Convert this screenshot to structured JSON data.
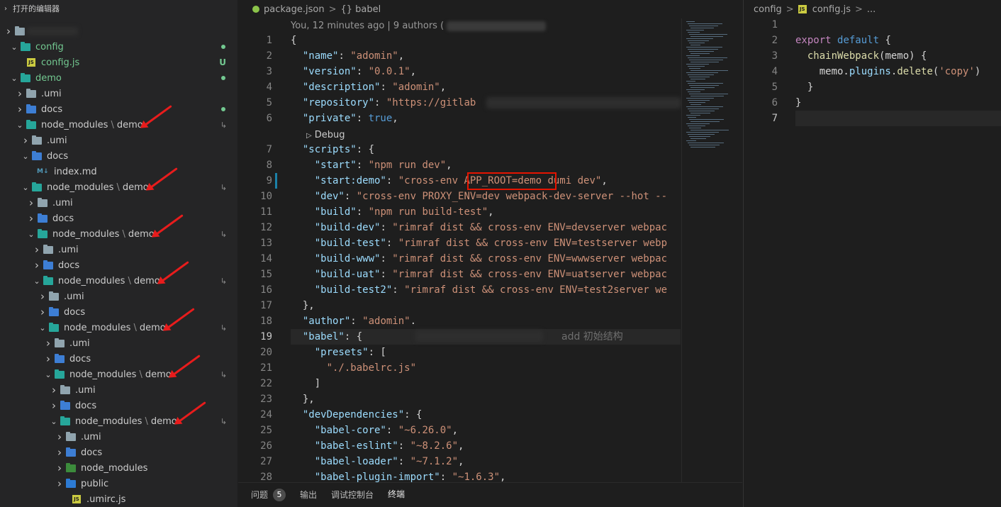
{
  "sidebar": {
    "open_editors_label": "打开的编辑器",
    "rows": [
      {
        "label": "",
        "kind": "folder",
        "indent": 0,
        "open": false,
        "green": false
      },
      {
        "label": "config",
        "kind": "folder-teal",
        "indent": 1,
        "open": true,
        "green": true,
        "badge": "dot"
      },
      {
        "label": "config.js",
        "kind": "js",
        "indent": 2,
        "open": null,
        "green": true,
        "badge": "U"
      },
      {
        "label": "demo",
        "kind": "folder-teal",
        "indent": 1,
        "open": true,
        "green": true,
        "badge": "dot"
      },
      {
        "label": ".umi",
        "kind": "folder",
        "indent": 2,
        "open": false,
        "green": false
      },
      {
        "label": "docs",
        "kind": "folder-docs",
        "indent": 2,
        "open": false,
        "green": false,
        "badge": "dot"
      },
      {
        "label": "node_modules",
        "suffix": "demo",
        "kind": "folder-teal",
        "indent": 2,
        "open": true,
        "green": false,
        "badge": "link"
      },
      {
        "label": ".umi",
        "kind": "folder",
        "indent": 3,
        "open": false,
        "green": false
      },
      {
        "label": "docs",
        "kind": "folder-docs",
        "indent": 3,
        "open": true,
        "green": false
      },
      {
        "label": "index.md",
        "kind": "md",
        "indent": 4,
        "open": null,
        "green": false
      },
      {
        "label": "node_modules",
        "suffix": "demo",
        "kind": "folder-teal",
        "indent": 3,
        "open": true,
        "green": false,
        "badge": "link"
      },
      {
        "label": ".umi",
        "kind": "folder",
        "indent": 4,
        "open": false,
        "green": false
      },
      {
        "label": "docs",
        "kind": "folder-docs",
        "indent": 4,
        "open": false,
        "green": false
      },
      {
        "label": "node_modules",
        "suffix": "demo",
        "kind": "folder-teal",
        "indent": 4,
        "open": true,
        "green": false,
        "badge": "link"
      },
      {
        "label": ".umi",
        "kind": "folder",
        "indent": 5,
        "open": false,
        "green": false
      },
      {
        "label": "docs",
        "kind": "folder-docs",
        "indent": 5,
        "open": false,
        "green": false
      },
      {
        "label": "node_modules",
        "suffix": "demo",
        "kind": "folder-teal",
        "indent": 5,
        "open": true,
        "green": false,
        "badge": "link"
      },
      {
        "label": ".umi",
        "kind": "folder",
        "indent": 6,
        "open": false,
        "green": false
      },
      {
        "label": "docs",
        "kind": "folder-docs",
        "indent": 6,
        "open": false,
        "green": false
      },
      {
        "label": "node_modules",
        "suffix": "demo",
        "kind": "folder-teal",
        "indent": 6,
        "open": true,
        "green": false,
        "badge": "link"
      },
      {
        "label": ".umi",
        "kind": "folder",
        "indent": 7,
        "open": false,
        "green": false
      },
      {
        "label": "docs",
        "kind": "folder-docs",
        "indent": 7,
        "open": false,
        "green": false
      },
      {
        "label": "node_modules",
        "suffix": "demo",
        "kind": "folder-teal",
        "indent": 7,
        "open": true,
        "green": false,
        "badge": "link"
      },
      {
        "label": ".umi",
        "kind": "folder",
        "indent": 8,
        "open": false,
        "green": false
      },
      {
        "label": "docs",
        "kind": "folder-docs",
        "indent": 8,
        "open": false,
        "green": false
      },
      {
        "label": "node_modules",
        "suffix": "demo",
        "kind": "folder-teal",
        "indent": 8,
        "open": true,
        "green": false,
        "badge": "link"
      },
      {
        "label": ".umi",
        "kind": "folder",
        "indent": 9,
        "open": false,
        "green": false
      },
      {
        "label": "docs",
        "kind": "folder-docs",
        "indent": 9,
        "open": false,
        "green": false
      },
      {
        "label": "node_modules",
        "kind": "folder-nm",
        "indent": 9,
        "open": false,
        "green": false
      },
      {
        "label": "public",
        "kind": "folder-public",
        "indent": 9,
        "open": false,
        "green": false
      },
      {
        "label": ".umirc.js",
        "kind": "js",
        "indent": 10,
        "open": null,
        "green": false
      }
    ]
  },
  "editor1": {
    "breadcrumb": {
      "file": "package.json",
      "sep": ">",
      "symbol": "{} babel"
    },
    "codelens_blame": "You, 12 minutes ago | 9 authors (",
    "debug_lens": "Debug",
    "inline_commit_hint": "add 初始结构",
    "lines": [
      {
        "n": "1",
        "segs": [
          [
            "p",
            "{"
          ]
        ]
      },
      {
        "n": "2",
        "segs": [
          [
            "p",
            "  "
          ],
          [
            "k",
            "\"name\""
          ],
          [
            "p",
            ": "
          ],
          [
            "s",
            "\"adomin\""
          ],
          [
            "p",
            ","
          ]
        ]
      },
      {
        "n": "3",
        "segs": [
          [
            "p",
            "  "
          ],
          [
            "k",
            "\"version\""
          ],
          [
            "p",
            ": "
          ],
          [
            "s",
            "\"0.0.1\""
          ],
          [
            "p",
            ","
          ]
        ]
      },
      {
        "n": "4",
        "segs": [
          [
            "p",
            "  "
          ],
          [
            "k",
            "\"description\""
          ],
          [
            "p",
            ": "
          ],
          [
            "s",
            "\"adomin\""
          ],
          [
            "p",
            ","
          ]
        ]
      },
      {
        "n": "5",
        "segs": [
          [
            "p",
            "  "
          ],
          [
            "k",
            "\"repository\""
          ],
          [
            "p",
            ": "
          ],
          [
            "s",
            "\"https://gitlab"
          ]
        ]
      },
      {
        "n": "6",
        "segs": [
          [
            "p",
            "  "
          ],
          [
            "k",
            "\"private\""
          ],
          [
            "p",
            ": "
          ],
          [
            "b",
            "true"
          ],
          [
            "p",
            ","
          ]
        ]
      },
      {
        "n": "7",
        "segs": [
          [
            "p",
            "  "
          ],
          [
            "k",
            "\"scripts\""
          ],
          [
            "p",
            ": {"
          ]
        ]
      },
      {
        "n": "8",
        "segs": [
          [
            "p",
            "    "
          ],
          [
            "k",
            "\"start\""
          ],
          [
            "p",
            ": "
          ],
          [
            "s",
            "\"npm run dev\""
          ],
          [
            "p",
            ","
          ]
        ]
      },
      {
        "n": "9",
        "segs": [
          [
            "p",
            "    "
          ],
          [
            "k",
            "\"start:demo\""
          ],
          [
            "p",
            ": "
          ],
          [
            "s",
            "\"cross-env APP_ROOT=demo dumi dev\""
          ],
          [
            "p",
            ","
          ]
        ]
      },
      {
        "n": "10",
        "segs": [
          [
            "p",
            "    "
          ],
          [
            "k",
            "\"dev\""
          ],
          [
            "p",
            ": "
          ],
          [
            "s",
            "\"cross-env PROXY_ENV=dev webpack-dev-server --hot --"
          ]
        ]
      },
      {
        "n": "11",
        "segs": [
          [
            "p",
            "    "
          ],
          [
            "k",
            "\"build\""
          ],
          [
            "p",
            ": "
          ],
          [
            "s",
            "\"npm run build-test\""
          ],
          [
            "p",
            ","
          ]
        ]
      },
      {
        "n": "12",
        "segs": [
          [
            "p",
            "    "
          ],
          [
            "k",
            "\"build-dev\""
          ],
          [
            "p",
            ": "
          ],
          [
            "s",
            "\"rimraf dist && cross-env ENV=devserver webpac"
          ]
        ]
      },
      {
        "n": "13",
        "segs": [
          [
            "p",
            "    "
          ],
          [
            "k",
            "\"build-test\""
          ],
          [
            "p",
            ": "
          ],
          [
            "s",
            "\"rimraf dist && cross-env ENV=testserver webp"
          ]
        ]
      },
      {
        "n": "14",
        "segs": [
          [
            "p",
            "    "
          ],
          [
            "k",
            "\"build-www\""
          ],
          [
            "p",
            ": "
          ],
          [
            "s",
            "\"rimraf dist && cross-env ENV=wwwserver webpac"
          ]
        ]
      },
      {
        "n": "15",
        "segs": [
          [
            "p",
            "    "
          ],
          [
            "k",
            "\"build-uat\""
          ],
          [
            "p",
            ": "
          ],
          [
            "s",
            "\"rimraf dist && cross-env ENV=uatserver webpac"
          ]
        ]
      },
      {
        "n": "16",
        "segs": [
          [
            "p",
            "    "
          ],
          [
            "k",
            "\"build-test2\""
          ],
          [
            "p",
            ": "
          ],
          [
            "s",
            "\"rimraf dist && cross-env ENV=test2server we"
          ]
        ]
      },
      {
        "n": "17",
        "segs": [
          [
            "p",
            "  },"
          ]
        ]
      },
      {
        "n": "18",
        "segs": [
          [
            "p",
            "  "
          ],
          [
            "k",
            "\"author\""
          ],
          [
            "p",
            ": "
          ],
          [
            "s",
            "\"adomin\""
          ],
          [
            "p",
            "."
          ]
        ]
      },
      {
        "n": "19",
        "segs": [
          [
            "p",
            "  "
          ],
          [
            "k",
            "\"babel\""
          ],
          [
            "p",
            ": {"
          ]
        ]
      },
      {
        "n": "20",
        "segs": [
          [
            "p",
            "    "
          ],
          [
            "k",
            "\"presets\""
          ],
          [
            "p",
            ": ["
          ]
        ]
      },
      {
        "n": "21",
        "segs": [
          [
            "p",
            "      "
          ],
          [
            "s",
            "\"./.babelrc.js\""
          ]
        ]
      },
      {
        "n": "22",
        "segs": [
          [
            "p",
            "    ]"
          ]
        ]
      },
      {
        "n": "23",
        "segs": [
          [
            "p",
            "  },"
          ]
        ]
      },
      {
        "n": "24",
        "segs": [
          [
            "p",
            "  "
          ],
          [
            "k",
            "\"devDependencies\""
          ],
          [
            "p",
            ": {"
          ]
        ]
      },
      {
        "n": "25",
        "segs": [
          [
            "p",
            "    "
          ],
          [
            "k",
            "\"babel-core\""
          ],
          [
            "p",
            ": "
          ],
          [
            "s",
            "\"~6.26.0\""
          ],
          [
            "p",
            ","
          ]
        ]
      },
      {
        "n": "26",
        "segs": [
          [
            "p",
            "    "
          ],
          [
            "k",
            "\"babel-eslint\""
          ],
          [
            "p",
            ": "
          ],
          [
            "s",
            "\"~8.2.6\""
          ],
          [
            "p",
            ","
          ]
        ]
      },
      {
        "n": "27",
        "segs": [
          [
            "p",
            "    "
          ],
          [
            "k",
            "\"babel-loader\""
          ],
          [
            "p",
            ": "
          ],
          [
            "s",
            "\"~7.1.2\""
          ],
          [
            "p",
            ","
          ]
        ]
      },
      {
        "n": "28",
        "segs": [
          [
            "p",
            "    "
          ],
          [
            "k",
            "\"babel-plugin-import\""
          ],
          [
            "p",
            ": "
          ],
          [
            "s",
            "\"~1.6.3\""
          ],
          [
            "p",
            ","
          ]
        ]
      }
    ]
  },
  "editor2": {
    "breadcrumb": {
      "folder": "config",
      "file": "config.js",
      "more": "..."
    },
    "lines": [
      {
        "n": "1",
        "segs": []
      },
      {
        "n": "2",
        "segs": [
          [
            "kw",
            "export"
          ],
          [
            "p",
            " "
          ],
          [
            "dflt",
            "default"
          ],
          [
            "p",
            " {"
          ]
        ]
      },
      {
        "n": "3",
        "segs": [
          [
            "p",
            "  "
          ],
          [
            "fn",
            "chainWebpack"
          ],
          [
            "p",
            "(memo) {"
          ]
        ]
      },
      {
        "n": "4",
        "segs": [
          [
            "p",
            "    memo."
          ],
          [
            "k",
            "plugins"
          ],
          [
            "p",
            "."
          ],
          [
            "fn",
            "delete"
          ],
          [
            "p",
            "("
          ],
          [
            "s",
            "'copy'"
          ],
          [
            "p",
            ")"
          ]
        ]
      },
      {
        "n": "5",
        "segs": [
          [
            "p",
            "  }"
          ]
        ]
      },
      {
        "n": "6",
        "segs": [
          [
            "p",
            "}"
          ]
        ]
      },
      {
        "n": "7",
        "segs": []
      }
    ]
  },
  "panel": {
    "tabs": [
      {
        "label": "问题",
        "badge": "5",
        "active": false
      },
      {
        "label": "输出",
        "active": false
      },
      {
        "label": "调试控制台",
        "active": false
      },
      {
        "label": "终端",
        "active": true
      }
    ]
  },
  "colors": {
    "annotation_red": "#e51400",
    "git_added": "#73c991"
  }
}
